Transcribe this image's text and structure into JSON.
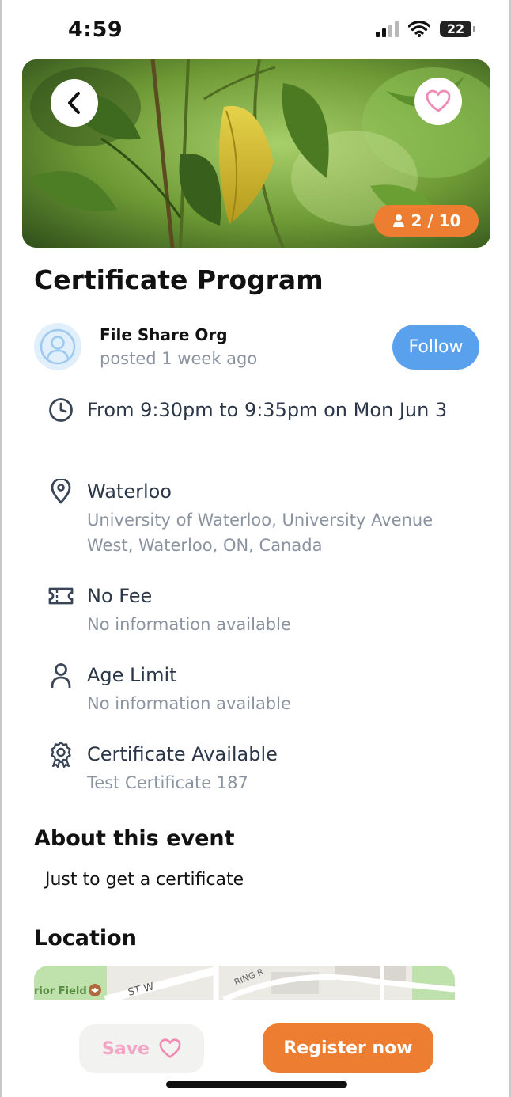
{
  "status_bar": {
    "time": "4:59",
    "battery": "22"
  },
  "hero": {
    "capacity": "2 / 10",
    "back_icon": "chevron-left-icon",
    "favorite_icon": "heart-outline-icon"
  },
  "event": {
    "title": "Certificate Program",
    "organizer": {
      "name": "File Share Org",
      "posted": "posted 1 week ago",
      "follow_label": "Follow"
    },
    "details": [
      {
        "icon": "clock-icon",
        "main": "From 9:30pm to 9:35pm on Mon Jun 3",
        "sub": ""
      },
      {
        "icon": "map-pin-icon",
        "main": "Waterloo",
        "sub": "University of Waterloo, University Avenue West, Waterloo, ON, Canada"
      },
      {
        "icon": "ticket-icon",
        "main": "No Fee",
        "sub": "No information available"
      },
      {
        "icon": "person-icon",
        "main": "Age Limit",
        "sub": "No information available"
      },
      {
        "icon": "award-badge-icon",
        "main": "Certificate Available",
        "sub": "Test Certificate 187"
      }
    ],
    "about_title": "About this event",
    "about_text": "Just to get a certificate",
    "location_title": "Location",
    "map_labels": {
      "field": "rior Field",
      "street": "ST W",
      "road": "RING R"
    }
  },
  "actions": {
    "save_label": "Save",
    "register_label": "Register now"
  },
  "colors": {
    "accent_orange": "#ec7d31",
    "follow_blue": "#5aa1ed",
    "heart_pink": "#f4a5c5"
  }
}
